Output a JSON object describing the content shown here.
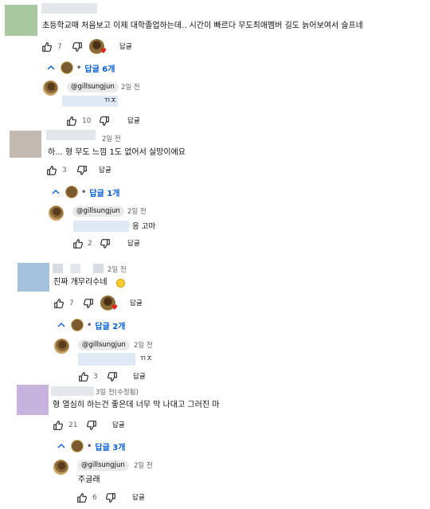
{
  "ui": {
    "reply_label": "답글",
    "comment_avatar_colors": [
      "#a8c8a0",
      "#c4b9b0",
      "#a3c1dc",
      "#c6b4de"
    ]
  },
  "comments": [
    {
      "timestamp": "",
      "text": "초등학교때 처음보고 이제 대학졸업하는데.. 시간이 빠르다 무도최애멤버 길도 늙어보여서 슬프네",
      "likes": "7",
      "replies_link": "답글 6개",
      "reply": {
        "handle": "@gillsungjun",
        "timestamp": "2일 전",
        "text": "ㄲㅈ",
        "likes": "10"
      }
    },
    {
      "timestamp": "2일 전",
      "text": "하... 형 무도 느낌 1도 없어서 실망이에요",
      "likes": "3",
      "replies_link": "답글 1개",
      "reply": {
        "handle": "@gillsungjun",
        "timestamp": "2일 전",
        "text": "응 고마",
        "likes": "2"
      }
    },
    {
      "timestamp": "2일 전",
      "text": "진짜 개무리수네",
      "likes": "7",
      "replies_link": "답글 2개",
      "reply": {
        "handle": "@gillsungjun",
        "timestamp": "2일 전",
        "text": "ㄲㅈ",
        "likes": "3"
      }
    },
    {
      "timestamp": "3일 전(수정됨)",
      "text": "형 열심히 하는건 좋은데 너무 막 나대고 그러진 마",
      "likes": "21",
      "replies_link": "답글 3개",
      "reply": {
        "handle": "@gillsungjun",
        "timestamp": "2일 전",
        "text": "주글래",
        "likes": "6"
      }
    }
  ]
}
